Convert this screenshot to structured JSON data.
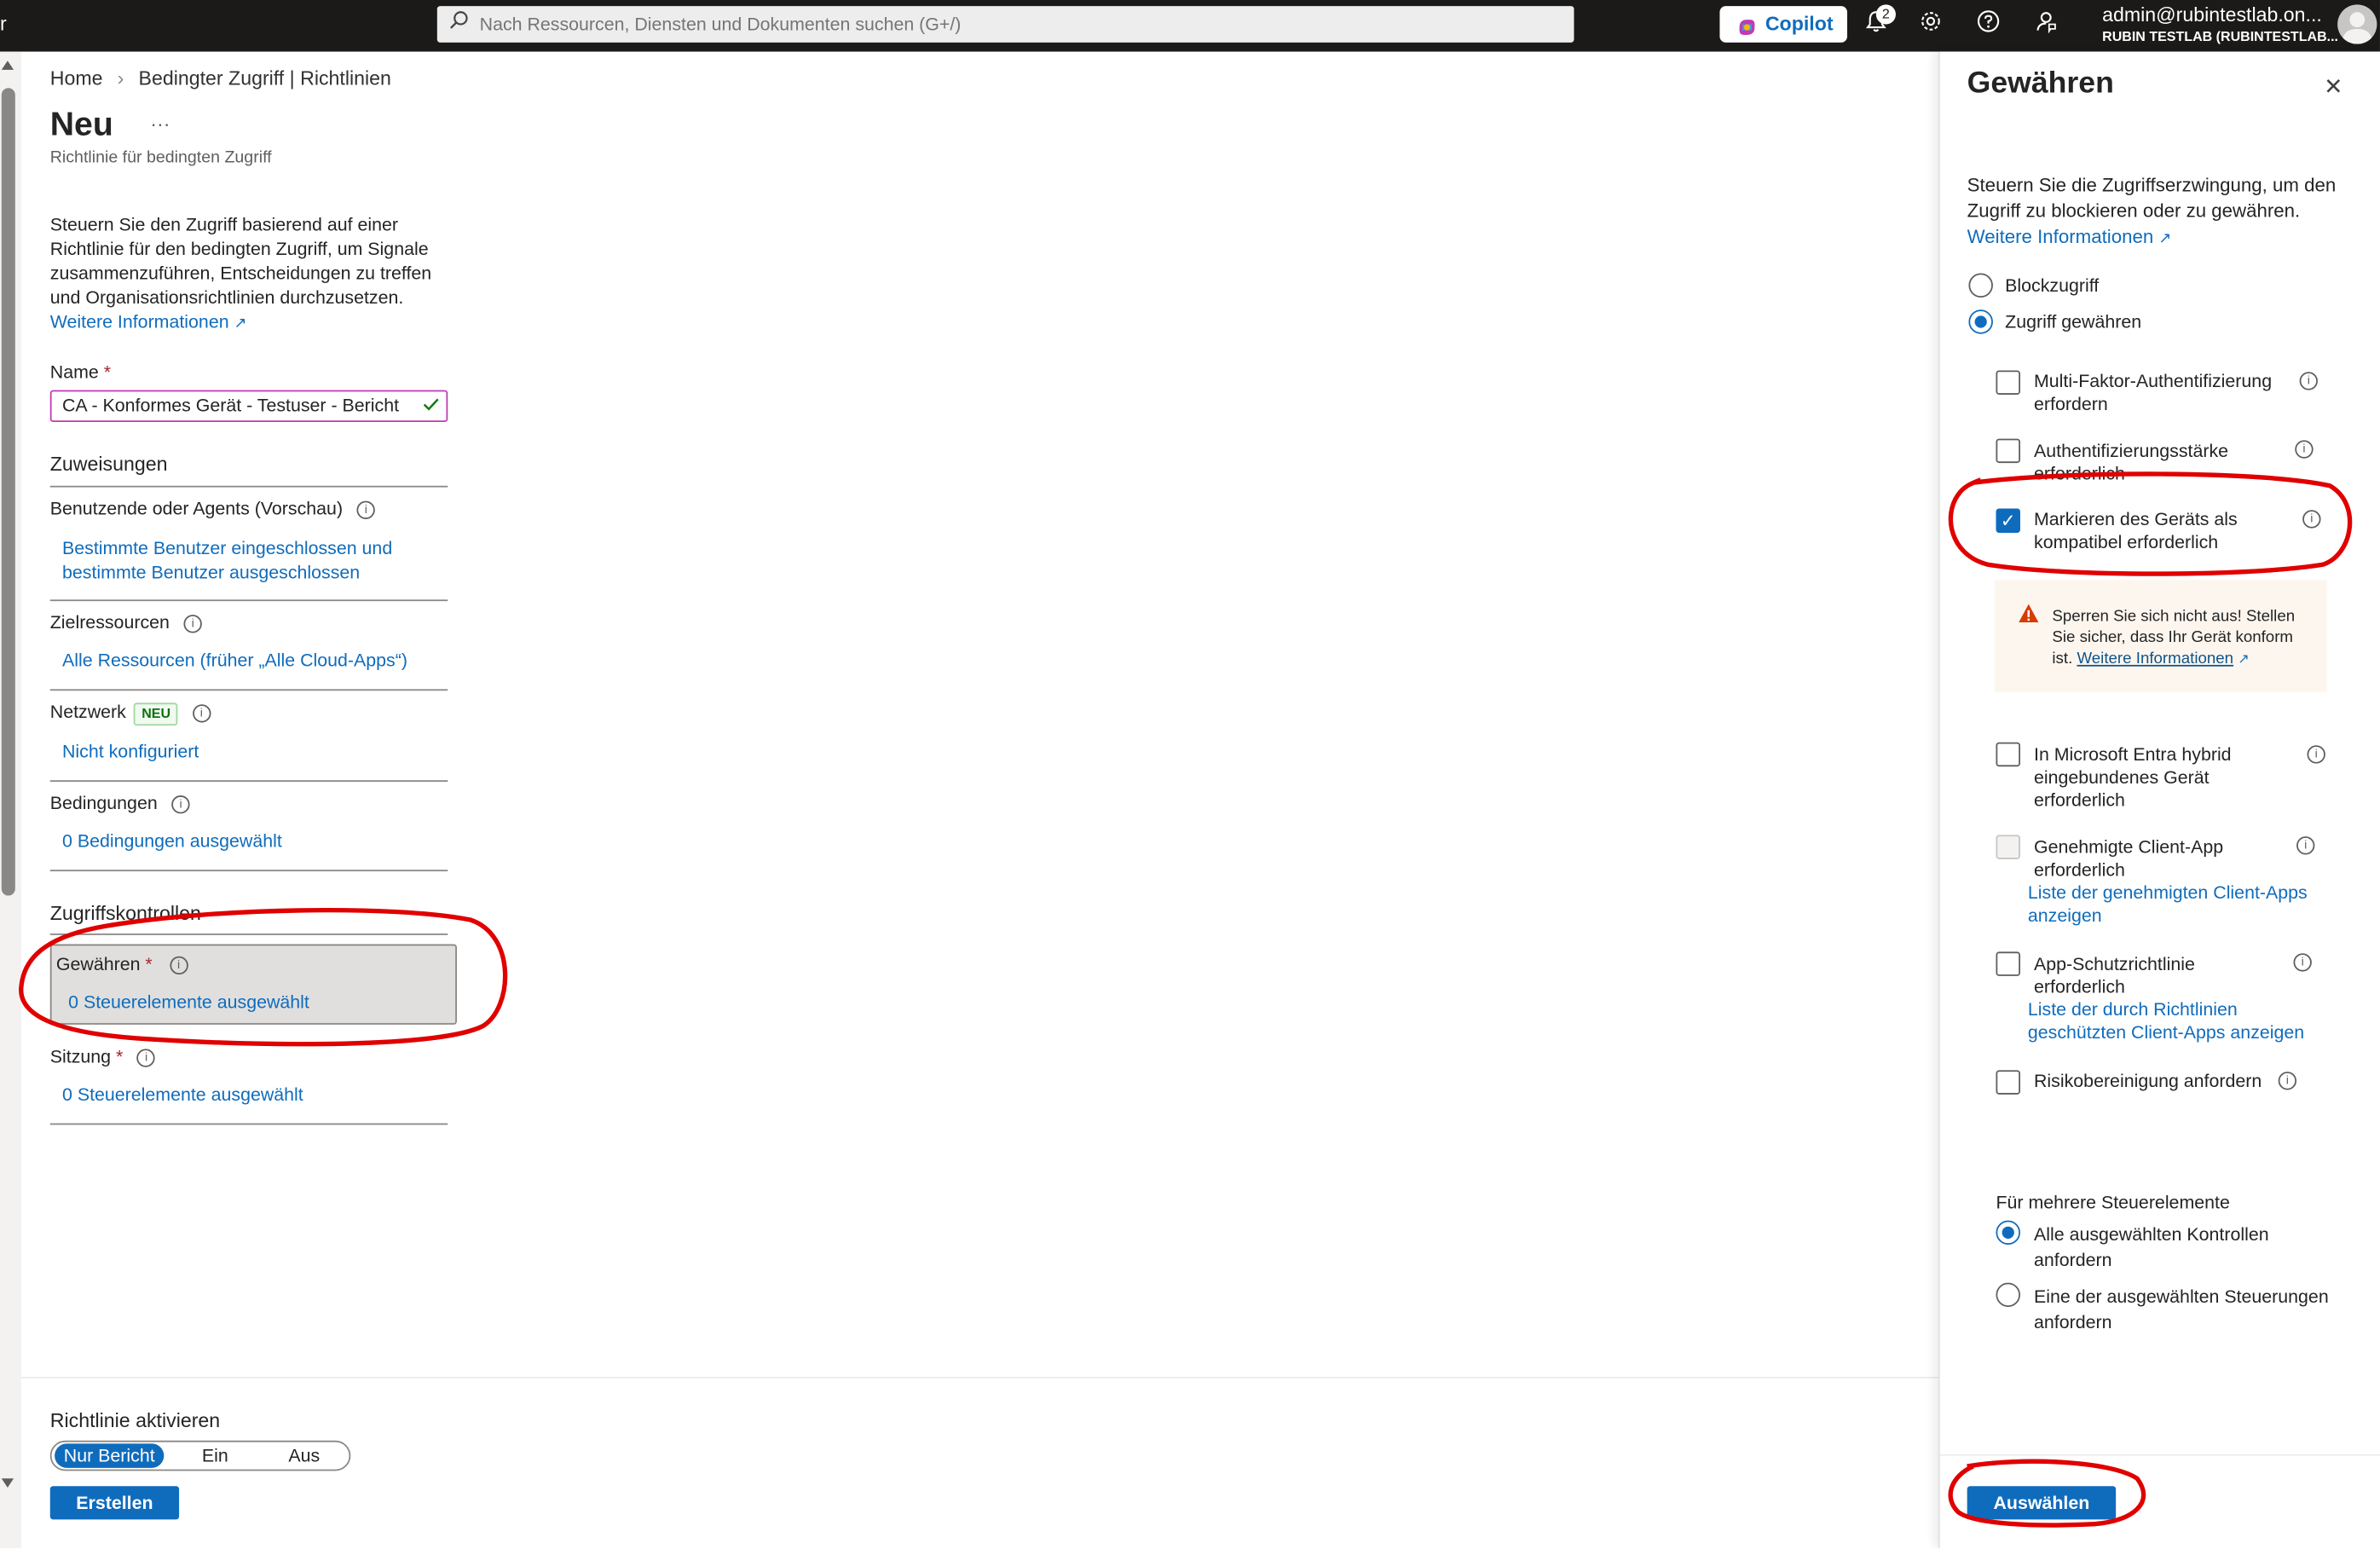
{
  "topbar": {
    "left_char": "r",
    "search_placeholder": "Nach Ressourcen, Diensten und Dokumenten suchen (G+/)",
    "copilot_label": "Copilot",
    "notification_count": "2",
    "user_email": "admin@rubintestlab.on...",
    "user_tenant": "RUBIN TESTLAB (RUBINTESTLAB...",
    "icons": [
      "search-icon",
      "copilot-icon",
      "bell-icon",
      "gear-icon",
      "help-icon",
      "feedback-icon"
    ]
  },
  "breadcrumb": {
    "home": "Home",
    "separator": "›",
    "current": "Bedingter Zugriff | Richtlinien"
  },
  "page": {
    "title": "Neu",
    "more": "···",
    "subtitle": "Richtlinie für bedingten Zugriff",
    "description": "Steuern Sie den Zugriff basierend auf einer Richtlinie für den bedingten Zugriff, um Signale zusammenzuführen, Entscheidungen zu treffen und Organisationsrichtlinien durchzusetzen.",
    "more_info": "Weitere Informationen",
    "name_label": "Name",
    "required_mark": "*",
    "name_value": "CA - Konformes Gerät - Testuser - Bericht"
  },
  "assignments": {
    "header": "Zuweisungen",
    "users_label": "Benutzende oder Agents (Vorschau)",
    "users_value": "Bestimmte Benutzer eingeschlossen und bestimmte Benutzer ausgeschlossen",
    "target_label": "Zielressourcen",
    "target_value": "Alle Ressourcen (früher „Alle Cloud-Apps“)",
    "network_label": "Netzwerk",
    "network_badge": "NEU",
    "network_value": "Nicht konfiguriert",
    "conditions_label": "Bedingungen",
    "conditions_value": "0 Bedingungen ausgewählt"
  },
  "access_controls": {
    "header": "Zugriffskontrollen",
    "grant_label": "Gewähren",
    "grant_value": "0 Steuerelemente ausgewählt",
    "session_label": "Sitzung",
    "session_value": "0 Steuerelemente ausgewählt"
  },
  "enable_policy": {
    "label": "Richtlinie aktivieren",
    "options": [
      "Nur Bericht",
      "Ein",
      "Aus"
    ],
    "selected": "Nur Bericht",
    "create_button": "Erstellen"
  },
  "panel": {
    "title": "Gewähren",
    "close": "✕",
    "description": "Steuern Sie die Zugriffserzwingung, um den Zugriff zu blockieren oder zu gewähren.",
    "more_info": "Weitere Informationen",
    "block_label": "Blockzugriff",
    "grant_label": "Zugriff gewähren",
    "selected_mode": "Zugriff gewähren",
    "controls": [
      {
        "label": "Multi-Faktor-Authentifizierung erfordern",
        "checked": false
      },
      {
        "label": "Authentifizierungsstärke erforderlich",
        "checked": false
      },
      {
        "label": "Markieren des Geräts als kompatibel erforderlich",
        "checked": true
      },
      {
        "label": "In Microsoft Entra hybrid eingebundenes Gerät erforderlich",
        "checked": false
      },
      {
        "label": "Genehmigte Client-App erforderlich",
        "checked": false,
        "disabled": true,
        "link": "Liste der genehmigten Client-Apps anzeigen"
      },
      {
        "label": "App-Schutzrichtlinie erforderlich",
        "checked": false,
        "link": "Liste der durch Richtlinien geschützten Client-Apps anzeigen"
      },
      {
        "label": "Risikobereinigung anfordern",
        "checked": false
      }
    ],
    "warning_text": "Sperren Sie sich nicht aus! Stellen Sie sicher, dass Ihr Gerät konform ist.",
    "warning_link": "Weitere Informationen",
    "multi_header": "Für mehrere Steuerelemente",
    "multi_all": "Alle ausgewählten Kontrollen anfordern",
    "multi_one": "Eine der ausgewählten Steuerungen anfordern",
    "multi_selected": "Alle ausgewählten Kontrollen anfordern",
    "select_button": "Auswählen"
  },
  "colors": {
    "accent": "#0f6cbd",
    "topbar": "#1b1a19",
    "annotation": "#e00000",
    "warning_bg": "#fdf6ee",
    "warning_icon": "#d83b01"
  }
}
